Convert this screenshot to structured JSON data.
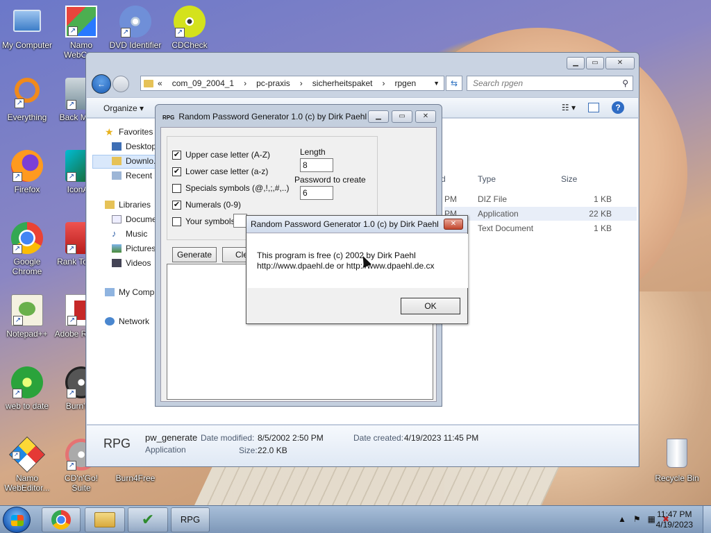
{
  "desktop": {
    "icons": [
      {
        "label": "My Computer"
      },
      {
        "label": "Namo WebCa..."
      },
      {
        "label": "DVD Identifier"
      },
      {
        "label": "CDCheck"
      },
      {
        "label": "Everything"
      },
      {
        "label": "Back Mak..."
      },
      {
        "label": "Firefox"
      },
      {
        "label": "IconA..."
      },
      {
        "label": "Google Chrome"
      },
      {
        "label": "Rank Toolb..."
      },
      {
        "label": "Notepad++"
      },
      {
        "label": "Adobe R... 6.0"
      },
      {
        "label": "web to date"
      },
      {
        "label": "Burn'n..."
      },
      {
        "label": "Namo WebEditor..."
      },
      {
        "label": "CD'n'Go! Suite"
      },
      {
        "label": "Burn4Free"
      },
      {
        "label": "Recycle Bin"
      }
    ]
  },
  "explorer": {
    "address": [
      "com_09_2004_1",
      "pc-praxis",
      "sicherheitspaket",
      "rpgen"
    ],
    "address_prefix": "«",
    "search_placeholder": "Search rpgen",
    "toolbar": {
      "organize": "Organize ▾"
    },
    "nav": {
      "favorites": "Favorites",
      "desktop": "Desktop",
      "downloads": "Downlo...",
      "recent": "Recent P...",
      "libraries": "Libraries",
      "documents": "Docume...",
      "music": "Music",
      "pictures": "Pictures",
      "videos": "Videos",
      "my_computer": "My Comp...",
      "network": "Network"
    },
    "columns": {
      "date_fragment": "d",
      "type": "Type",
      "size": "Size"
    },
    "rows": [
      {
        "time": "PM",
        "type": "DIZ File",
        "size": "1 KB"
      },
      {
        "time": "PM",
        "type": "Application",
        "size": "22 KB"
      },
      {
        "time": "PM",
        "type": "Text Document",
        "size": "1 KB"
      }
    ],
    "details": {
      "icon_text": "RPG",
      "name": "pw_generate",
      "kind": "Application",
      "modified_label": "Date modified:",
      "modified": "8/5/2002 2:50 PM",
      "created_label": "Date created:",
      "created": "4/19/2023 11:45 PM",
      "size_label": "Size:",
      "size": "22.0 KB"
    }
  },
  "rpg": {
    "logo": "RPG",
    "title": "Random Password Generator 1.0 (c) by Dirk Paehl",
    "options": {
      "upper": "Upper case letter (A-Z)",
      "lower": "Lower case letter (a-z)",
      "specials": "Specials symbols (@,!,;,#,..)",
      "numerals": "Numerals (0-9)",
      "yours": "Your symbols"
    },
    "check_mark": "✔",
    "length_label": "Length",
    "length_value": "8",
    "create_label": "Password to create",
    "create_value": "6",
    "generate": "Generate",
    "clear": "Cle"
  },
  "about": {
    "title": "Random Password Generator 1.0 (c) by Dirk Paehl",
    "line1": "This program is free (c) 2002 by Dirk Paehl",
    "line2": "http://www.dpaehl.de or http://www.dpaehl.de.cx",
    "ok": "OK"
  },
  "taskbar": {
    "rpg_label": "RPG",
    "time": "11:47 PM",
    "date": "4/19/2023"
  }
}
